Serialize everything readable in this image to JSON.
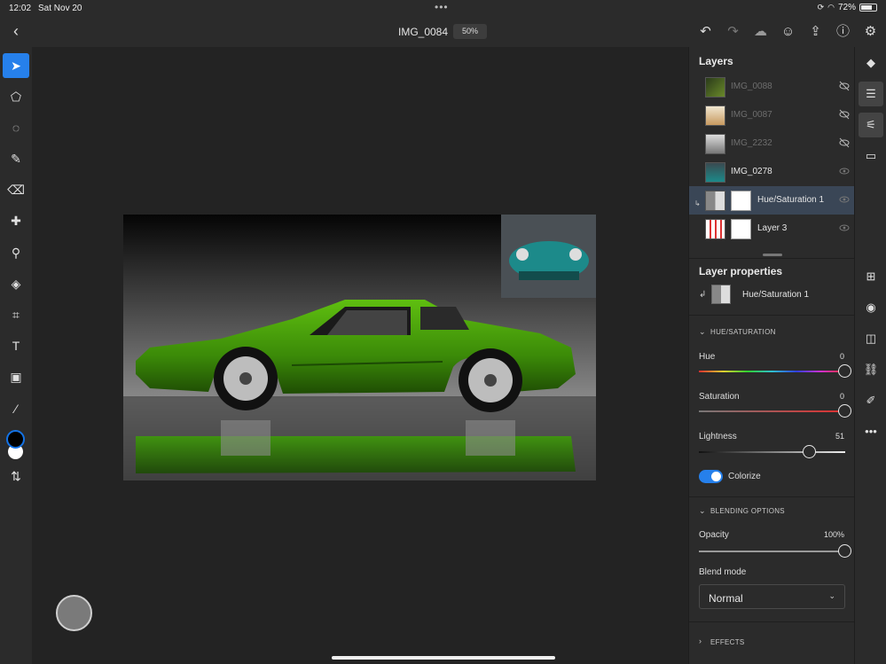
{
  "status": {
    "time": "12:02",
    "date": "Sat Nov 20",
    "battery": "72%",
    "battery_level": 0.72
  },
  "document": {
    "title": "IMG_0084",
    "zoom": "50%"
  },
  "toolbar_top": {
    "icons": [
      "undo-icon",
      "redo-icon",
      "cloud-icon",
      "share-user-icon",
      "export-icon",
      "help-icon",
      "settings-gear-icon"
    ]
  },
  "left_tools": [
    {
      "name": "select-tool",
      "icon": "arrow-pointer-icon",
      "active": true
    },
    {
      "name": "transform-tool",
      "icon": "transform-icon"
    },
    {
      "name": "lasso-tool",
      "icon": "lasso-icon"
    },
    {
      "name": "brush-tool",
      "icon": "brush-icon"
    },
    {
      "name": "eraser-tool",
      "icon": "eraser-icon"
    },
    {
      "name": "healing-tool",
      "icon": "bandage-icon"
    },
    {
      "name": "clone-tool",
      "icon": "stamp-icon"
    },
    {
      "name": "fill-tool",
      "icon": "paint-bucket-icon"
    },
    {
      "name": "crop-tool",
      "icon": "crop-icon"
    },
    {
      "name": "type-tool",
      "icon": "type-icon"
    },
    {
      "name": "image-tool",
      "icon": "image-icon"
    },
    {
      "name": "eyedropper-tool",
      "icon": "eyedropper-icon"
    }
  ],
  "colors": {
    "foreground": "#000000",
    "background": "#ffffff",
    "accent": "#2680eb"
  },
  "layers_panel": {
    "title": "Layers",
    "layers": [
      {
        "name": "IMG_0088",
        "visible": false,
        "dim": true
      },
      {
        "name": "IMG_0087",
        "visible": false,
        "dim": true
      },
      {
        "name": "IMG_2232",
        "visible": false,
        "dim": true
      },
      {
        "name": "IMG_0278",
        "visible": true,
        "dim": false
      },
      {
        "name": "Hue/Saturation 1",
        "visible": true,
        "dim": false,
        "selected": true
      },
      {
        "name": "Layer 3",
        "visible": true,
        "dim": false
      }
    ]
  },
  "layer_properties": {
    "title": "Layer properties",
    "layer_name": "Hue/Saturation 1",
    "hue_saturation": {
      "section": "HUE/SATURATION",
      "hue_label": "Hue",
      "hue_value": "0",
      "hue_fraction": 1.0,
      "saturation_label": "Saturation",
      "saturation_value": "0",
      "saturation_fraction": 1.0,
      "lightness_label": "Lightness",
      "lightness_value": "51",
      "lightness_fraction": 0.76,
      "colorize_label": "Colorize",
      "colorize_on": true
    },
    "blending": {
      "section": "BLENDING OPTIONS",
      "opacity_label": "Opacity",
      "opacity_value": "100%",
      "opacity_fraction": 1.0,
      "blend_mode_label": "Blend mode",
      "blend_mode_value": "Normal"
    },
    "effects": {
      "section": "EFFECTS"
    }
  },
  "right_rail": [
    "layers-icon",
    "layer-stack-icon",
    "adjustments-icon",
    "comment-icon",
    "add-layer-icon",
    "visibility-eye-icon",
    "mask-icon",
    "link-icon",
    "eraser-mask-icon",
    "more-icon"
  ]
}
